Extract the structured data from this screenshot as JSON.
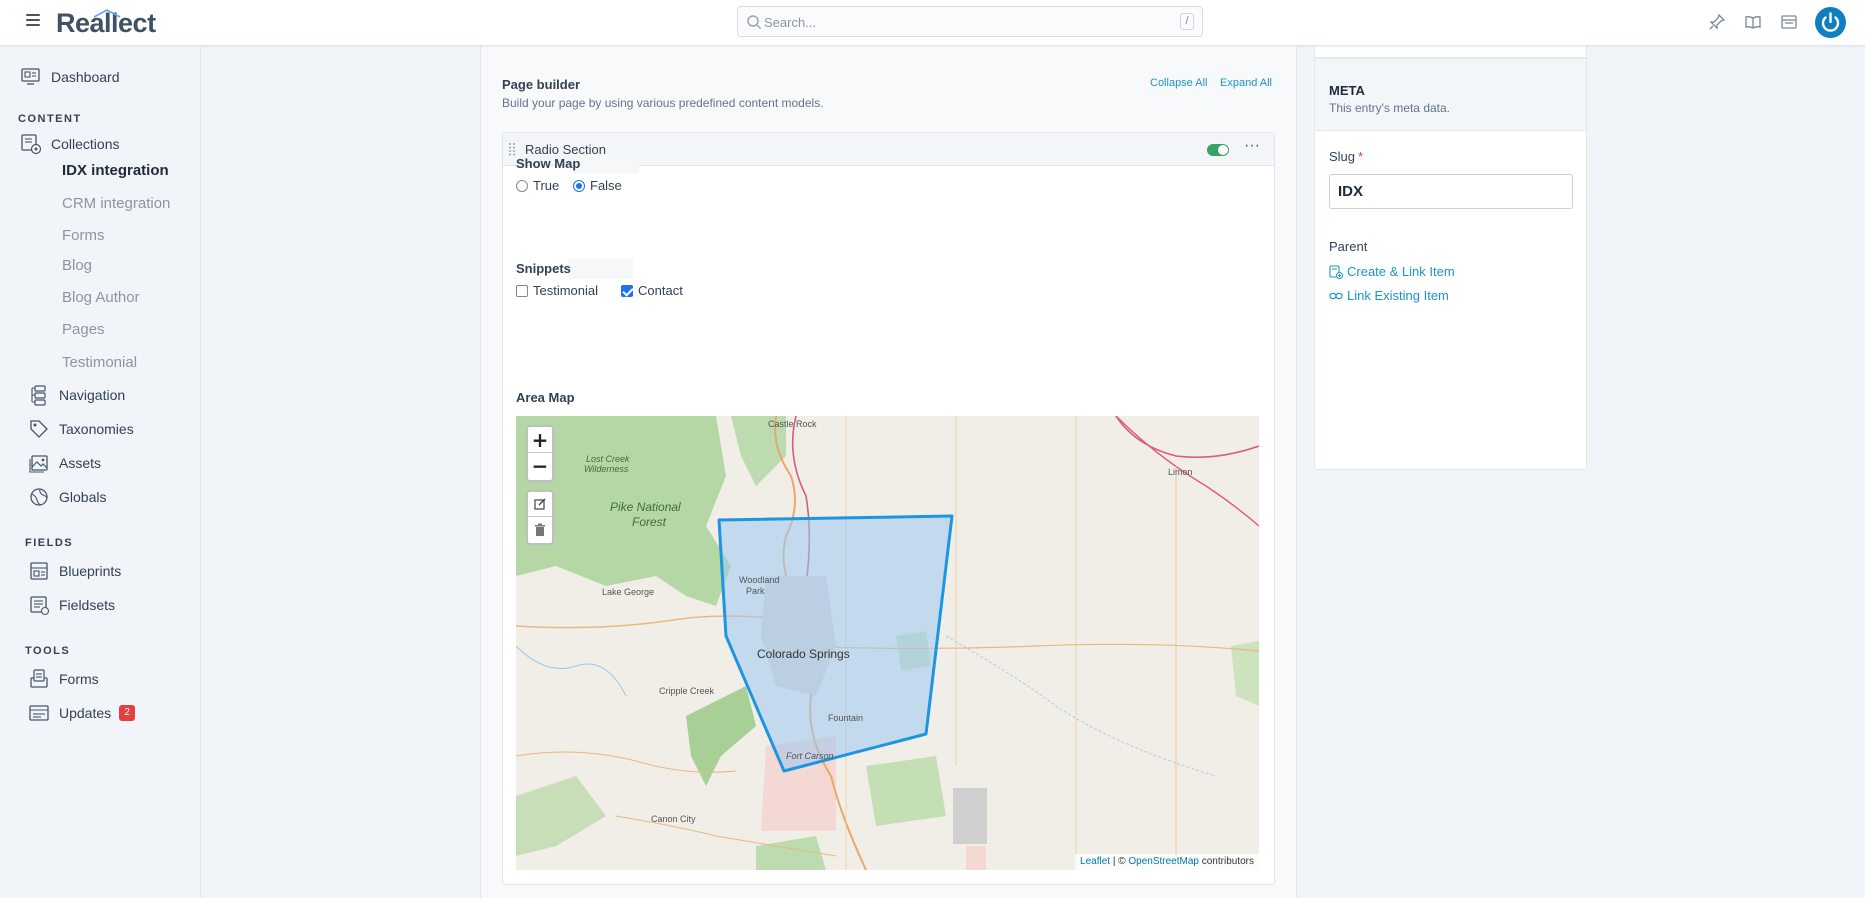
{
  "header": {
    "logo_text": "Reallect",
    "search_placeholder": "Search...",
    "search_shortcut": "/"
  },
  "sidebar": {
    "dashboard": "Dashboard",
    "content_heading": "CONTENT",
    "collections": "Collections",
    "collection_items": [
      "IDX integration",
      "CRM integration",
      "Forms",
      "Blog",
      "Blog Author",
      "Pages",
      "Testimonial"
    ],
    "navigation": "Navigation",
    "taxonomies": "Taxonomies",
    "assets": "Assets",
    "globals": "Globals",
    "fields_heading": "FIELDS",
    "blueprints": "Blueprints",
    "fieldsets": "Fieldsets",
    "tools_heading": "TOOLS",
    "forms": "Forms",
    "updates": "Updates",
    "updates_badge": "2"
  },
  "page_builder": {
    "title": "Page builder",
    "subtitle": "Build your page by using various predefined content models.",
    "collapse_all": "Collapse All",
    "expand_all": "Expand All"
  },
  "section": {
    "title": "Radio Section",
    "enabled": true,
    "show_map": {
      "label": "Show Map",
      "options": [
        "True",
        "False"
      ],
      "selected": "False"
    },
    "snippets": {
      "label": "Snippets",
      "options": [
        "Testimonial",
        "Contact"
      ],
      "checked": [
        "Contact"
      ]
    },
    "area_map": {
      "label": "Area Map",
      "zoom_in": "+",
      "zoom_out": "−",
      "attribution_leaflet": "Leaflet",
      "attribution_sep": " | © ",
      "attribution_osm": "OpenStreetMap",
      "attribution_tail": " contributors",
      "place_labels": {
        "castle_rock": "Castle Rock",
        "lost_creek": "Lost Creek",
        "wilderness": "Wilderness",
        "pike": "Pike National",
        "forest": "Forest",
        "limon": "Limon",
        "lake_george": "Lake George",
        "woodland": "Woodland",
        "park": "Park",
        "colorado_springs": "Colorado Springs",
        "cripple_creek": "Cripple Creek",
        "fountain": "Fountain",
        "fort_carson": "Fort Carson",
        "canon_city": "Canon City"
      },
      "colors": {
        "polygon_stroke": "#1e95e0",
        "polygon_fill": "#9cc8f0",
        "forest": "#b5d6a5"
      }
    }
  },
  "meta_panel": {
    "title": "META",
    "subtitle": "This entry's meta data.",
    "slug_label": "Slug",
    "slug_required": "*",
    "slug_value": "IDX",
    "parent_label": "Parent",
    "create_link": "Create & Link Item",
    "link_existing": "Link Existing Item"
  }
}
